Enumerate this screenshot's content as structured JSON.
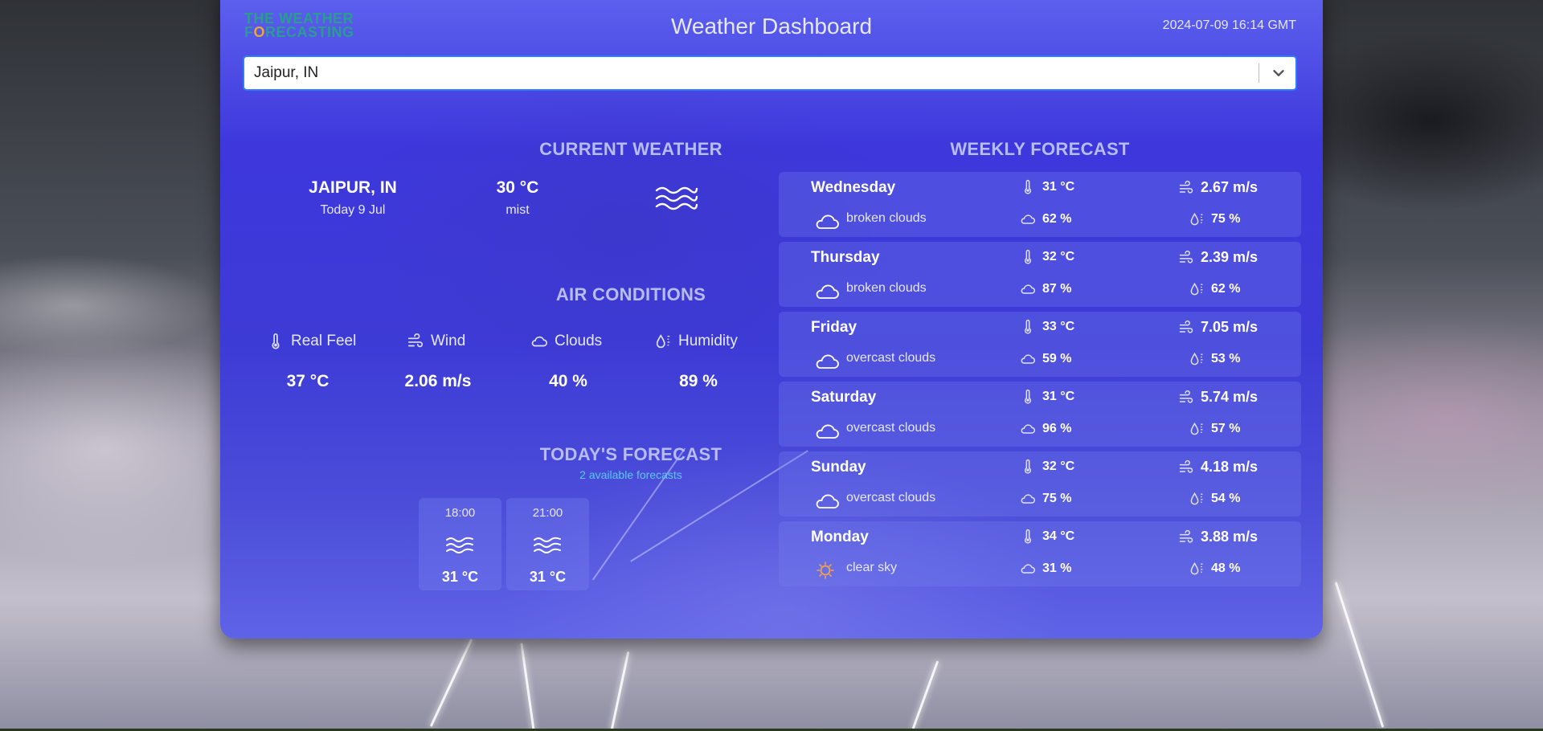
{
  "app": {
    "logo_line1": "THE WEATHER",
    "logo_accent": "O",
    "logo_line2_prefix": "F",
    "logo_line2_suffix": "RECASTING",
    "title": "Weather Dashboard",
    "datetime": "2024-07-09 16:14 GMT"
  },
  "search": {
    "value": "Jaipur, IN",
    "icon": "chevron-down-icon"
  },
  "current": {
    "title": "CURRENT WEATHER",
    "city": "JAIPUR, IN",
    "date": "Today 9 Jul",
    "temp": "30 °C",
    "description": "mist",
    "icon": "mist-icon"
  },
  "air": {
    "title": "AIR CONDITIONS",
    "items": [
      {
        "label": "Real Feel",
        "value": "37 °C",
        "icon": "thermometer-icon"
      },
      {
        "label": "Wind",
        "value": "2.06 m/s",
        "icon": "wind-icon"
      },
      {
        "label": "Clouds",
        "value": "40 %",
        "icon": "cloud-icon"
      },
      {
        "label": "Humidity",
        "value": "89 %",
        "icon": "humidity-icon"
      }
    ]
  },
  "today": {
    "title": "TODAY'S FORECAST",
    "subtitle": "2 available forecasts",
    "items": [
      {
        "time": "18:00",
        "temp": "31 °C",
        "icon": "mist-icon"
      },
      {
        "time": "21:00",
        "temp": "31 °C",
        "icon": "mist-icon"
      }
    ]
  },
  "weekly": {
    "title": "WEEKLY FORECAST",
    "days": [
      {
        "day": "Wednesday",
        "description": "broken clouds",
        "icon": "cloud-icon",
        "temp": "31 °C",
        "clouds": "62 %",
        "wind": "2.67 m/s",
        "humidity": "75 %"
      },
      {
        "day": "Thursday",
        "description": "broken clouds",
        "icon": "cloud-icon",
        "temp": "32 °C",
        "clouds": "87 %",
        "wind": "2.39 m/s",
        "humidity": "62 %"
      },
      {
        "day": "Friday",
        "description": "overcast clouds",
        "icon": "cloud-icon",
        "temp": "33 °C",
        "clouds": "59 %",
        "wind": "7.05 m/s",
        "humidity": "53 %"
      },
      {
        "day": "Saturday",
        "description": "overcast clouds",
        "icon": "cloud-icon",
        "temp": "31 °C",
        "clouds": "96 %",
        "wind": "5.74 m/s",
        "humidity": "57 %"
      },
      {
        "day": "Sunday",
        "description": "overcast clouds",
        "icon": "cloud-icon",
        "temp": "32 °C",
        "clouds": "75 %",
        "wind": "4.18 m/s",
        "humidity": "54 %"
      },
      {
        "day": "Monday",
        "description": "clear sky",
        "icon": "sun-icon",
        "temp": "34 °C",
        "clouds": "31 %",
        "wind": "3.88 m/s",
        "humidity": "48 %"
      }
    ]
  },
  "colors": {
    "panel": "#3d37dc",
    "accent": "#2d7cff",
    "section_title": "#b8bcf5",
    "subtitle": "#58c9f0",
    "sun": "#f0a34a"
  }
}
